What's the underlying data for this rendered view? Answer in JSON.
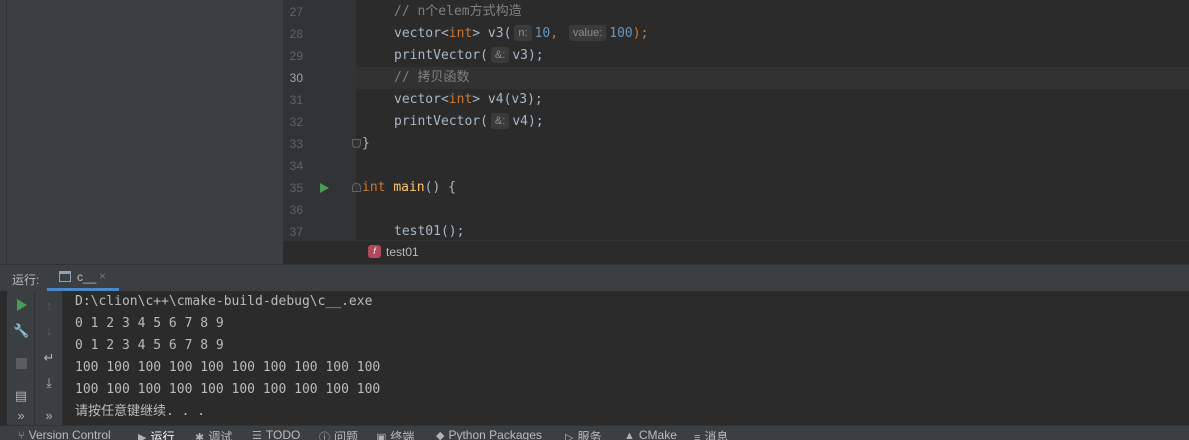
{
  "editor": {
    "lines": [
      {
        "num": "27",
        "current": false
      },
      {
        "num": "28",
        "current": false
      },
      {
        "num": "29",
        "current": false
      },
      {
        "num": "30",
        "current": true
      },
      {
        "num": "31",
        "current": false
      },
      {
        "num": "32",
        "current": false
      },
      {
        "num": "33",
        "current": false
      },
      {
        "num": "34",
        "current": false
      },
      {
        "num": "35",
        "current": false
      },
      {
        "num": "36",
        "current": false
      },
      {
        "num": "37",
        "current": false
      }
    ],
    "code": {
      "l27_comment": "// n个elem方式构造",
      "l28_type": "vector<",
      "l28_kw": "int",
      "l28_rest": "> v3(",
      "l28_hint1": "n:",
      "l28_num1": "10",
      "l28_comma": ", ",
      "l28_hint2": "value:",
      "l28_num2": "100",
      "l28_end": ");",
      "l29_fn": "printVector(",
      "l29_hint": "&:",
      "l29_arg": "v3);",
      "l30_comment": "// 拷贝函数",
      "l31_type": "vector<",
      "l31_kw": "int",
      "l31_rest": "> v4(v3);",
      "l32_fn": "printVector(",
      "l32_hint": "&:",
      "l32_arg": "v4);",
      "l33_brace": "}",
      "l35_kw": "int",
      "l35_fn": "main",
      "l35_rest": "() {",
      "l37_fn": "test01",
      "l37_rest": "();"
    },
    "breadcrumb": {
      "icon": "f",
      "label": "test01"
    }
  },
  "run_window": {
    "label": "运行:",
    "tab_label": "c__",
    "tab_close": "×",
    "console_lines": [
      "D:\\clion\\c++\\cmake-build-debug\\c__.exe",
      "0 1 2 3 4 5 6 7 8 9",
      "0 1 2 3 4 5 6 7 8 9",
      "100 100 100 100 100 100 100 100 100 100",
      "100 100 100 100 100 100 100 100 100 100",
      "请按任意键继续. . ."
    ]
  },
  "bottom_bar": {
    "items": [
      {
        "label": "Version Control",
        "icon": "branch-icon"
      },
      {
        "label": "运行",
        "icon": "run-icon"
      },
      {
        "label": "调试",
        "icon": "debug-icon"
      },
      {
        "label": "TODO",
        "icon": "list-icon"
      },
      {
        "label": "问题",
        "icon": "problems-icon"
      },
      {
        "label": "终端",
        "icon": "terminal-icon"
      },
      {
        "label": "Python Packages",
        "icon": "packages-icon"
      },
      {
        "label": "服务",
        "icon": "services-icon"
      },
      {
        "label": "CMake",
        "icon": "cmake-icon"
      },
      {
        "label": "消息",
        "icon": "messages-icon"
      }
    ]
  },
  "colors": {
    "keyword": "#cc7832",
    "comment": "#808080",
    "number": "#6897bb",
    "function": "#ffc66d",
    "run_green": "#499c54",
    "tab_accent": "#4a88c7"
  }
}
